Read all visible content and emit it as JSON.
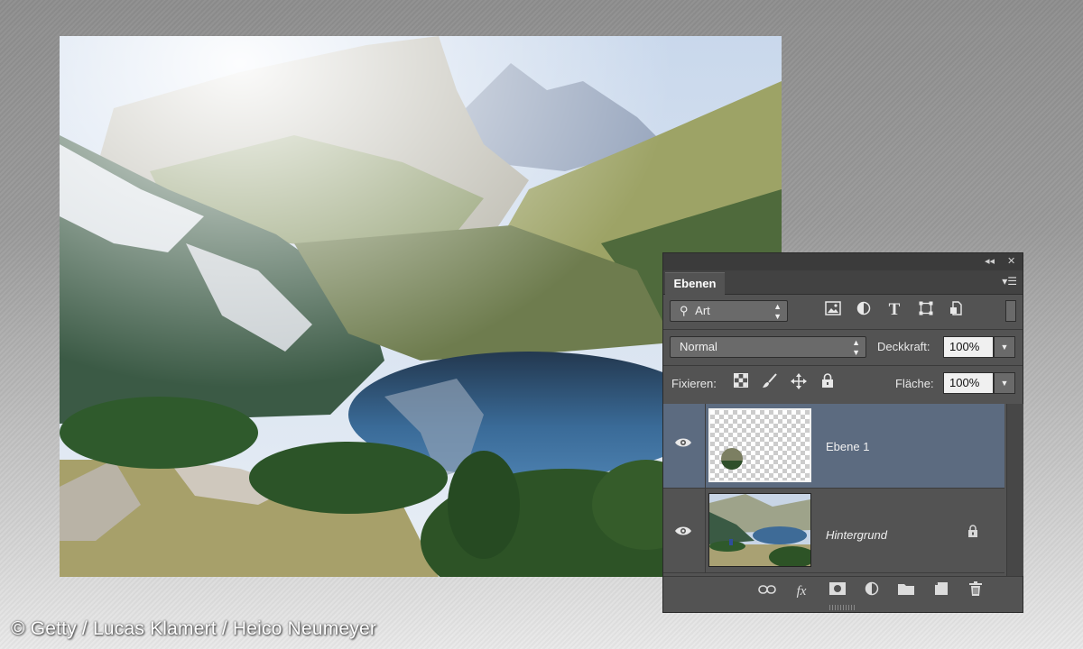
{
  "credit": "© Getty / Lucas Klamert / Heico Neumeyer",
  "panel": {
    "tab_label": "Ebenen",
    "filter": {
      "label": "Art",
      "icons": [
        "image-filter-icon",
        "adjustment-filter-icon",
        "type-filter-icon",
        "shape-filter-icon",
        "smart-object-filter-icon"
      ]
    },
    "blend_mode": "Normal",
    "opacity_label": "Deckkraft:",
    "opacity_value": "100%",
    "lock_label": "Fixieren:",
    "fill_label": "Fläche:",
    "fill_value": "100%",
    "layers": [
      {
        "name": "Ebene 1",
        "selected": true,
        "visible": true,
        "italic": false
      },
      {
        "name": "Hintergrund",
        "selected": false,
        "visible": true,
        "italic": true,
        "locked": true
      }
    ],
    "type_glyph": "T",
    "fx_glyph": "fx"
  }
}
